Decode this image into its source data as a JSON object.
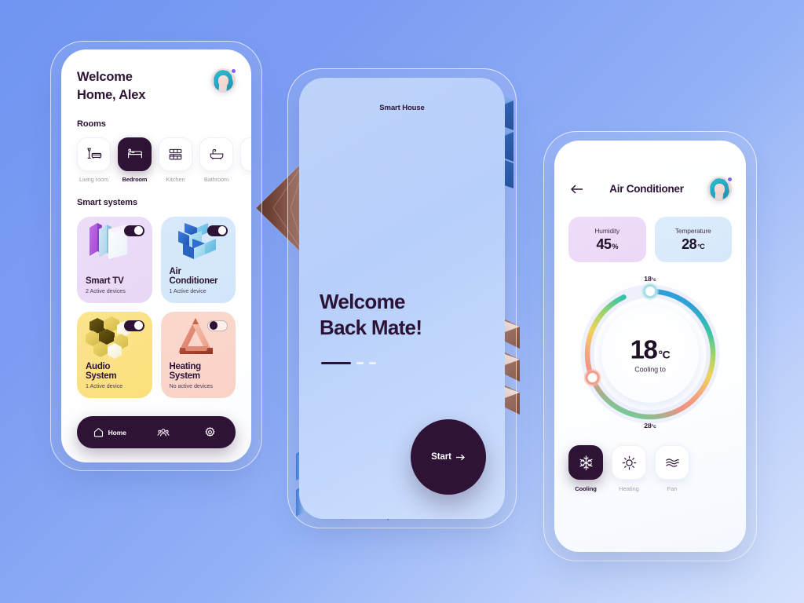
{
  "theme": {
    "background_gradient_from": "#6f95f2",
    "background_gradient_to": "#d6e2fc",
    "accent_dark": "#2e1336",
    "card_purple": "#ecddf8",
    "card_blue": "#d8e9fb",
    "card_yellow": "#fbe48c",
    "card_pink": "#fbd8cd"
  },
  "home_screen": {
    "greeting_line1": "Welcome",
    "greeting_line2": "Home, Alex",
    "avatar_name": "user-avatar",
    "rooms_title": "Rooms",
    "rooms": [
      {
        "label": "Living room",
        "icon": "floor-lamp-sofa-icon",
        "active": false
      },
      {
        "label": "Bedroom",
        "icon": "bed-icon",
        "active": true
      },
      {
        "label": "Kitchen",
        "icon": "kitchen-cabinets-icon",
        "active": false
      },
      {
        "label": "Bathroom",
        "icon": "bathtub-icon",
        "active": false
      },
      {
        "label": "",
        "icon": "more-room-icon",
        "active": false
      }
    ],
    "systems_title": "Smart systems",
    "systems": [
      {
        "name": "Smart TV",
        "status": "2 Active devices",
        "toggle": "on",
        "art": "purple-screens"
      },
      {
        "name": "Air Conditioner",
        "status": "1 Active device",
        "toggle": "on",
        "art": "blue-pinwheel"
      },
      {
        "name": "Audio System",
        "status": "1 Active device",
        "toggle": "on",
        "art": "gold-hexagons"
      },
      {
        "name": "Heating System",
        "status": "No active devices",
        "toggle": "off",
        "art": "rose-triangle"
      }
    ],
    "tabbar": [
      {
        "label": "Home",
        "icon": "home-icon",
        "active": true
      },
      {
        "label": "",
        "icon": "people-icon",
        "active": false
      },
      {
        "label": "",
        "icon": "gear-icon",
        "active": false
      }
    ]
  },
  "welcome_screen": {
    "app_title": "Smart House",
    "heading_line1": "Welcome",
    "heading_line2": "Back Mate!",
    "pagination": {
      "active_index": 0,
      "total": 3
    },
    "start_button": "Start",
    "start_icon": "arrow-right-icon"
  },
  "ac_screen": {
    "back_icon": "arrow-left-icon",
    "title": "Air Conditioner",
    "avatar_name": "user-avatar",
    "stats": [
      {
        "label": "Humidity",
        "value": "45",
        "unit": "%"
      },
      {
        "label": "Temperature",
        "value": "28",
        "unit": "°C"
      }
    ],
    "dial": {
      "min_label": "18",
      "min_unit": "°c",
      "max_label": "28",
      "max_unit": "°c",
      "current_value": "18",
      "current_unit": "°C",
      "caption": "Cooling to"
    },
    "modes": [
      {
        "label": "Cooling",
        "icon": "snowflake-icon",
        "active": true
      },
      {
        "label": "Heating",
        "icon": "sun-icon",
        "active": false
      },
      {
        "label": "Fan",
        "icon": "wave-lines-icon",
        "active": false
      }
    ]
  }
}
